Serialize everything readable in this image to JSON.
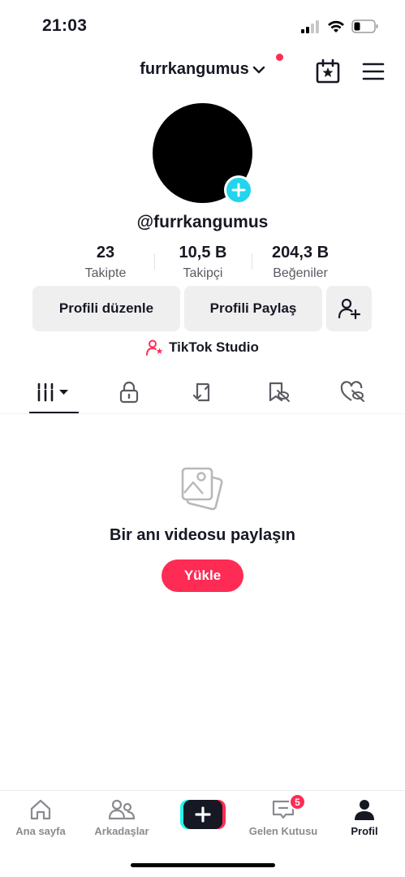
{
  "status_bar": {
    "time": "21:03"
  },
  "header": {
    "username": "furrkangumus"
  },
  "profile": {
    "handle": "@furrkangumus",
    "stats": [
      {
        "value": "23",
        "label": "Takipte"
      },
      {
        "value": "10,5 B",
        "label": "Takipçi"
      },
      {
        "value": "204,3 B",
        "label": "Beğeniler"
      }
    ],
    "edit_button": "Profili düzenle",
    "share_button": "Profili Paylaş",
    "studio_label": "TikTok Studio"
  },
  "tabs": [
    "videos-grid-icon",
    "lock-icon",
    "repost-icon",
    "favorites-hidden-icon",
    "liked-hidden-icon"
  ],
  "empty_state": {
    "title": "Bir anı videosu paylaşın",
    "upload_button": "Yükle"
  },
  "bottom_nav": {
    "items": [
      {
        "label": "Ana sayfa"
      },
      {
        "label": "Arkadaşlar"
      },
      {
        "label": ""
      },
      {
        "label": "Gelen Kutusu",
        "badge": "5"
      },
      {
        "label": "Profil"
      }
    ]
  },
  "colors": {
    "accent": "#fe2c55",
    "cyan": "#20d5ec",
    "text": "#161823"
  }
}
